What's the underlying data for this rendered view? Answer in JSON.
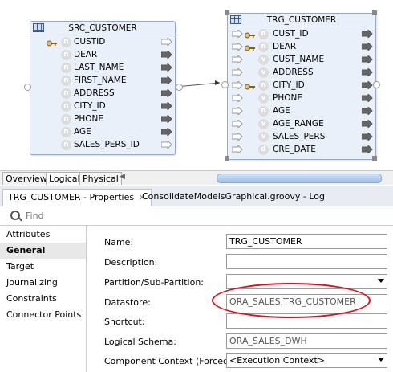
{
  "src_entity": {
    "title": "SRC_CUSTOMER",
    "attributes": [
      {
        "name": "CUSTID",
        "key": true,
        "out": "hollow"
      },
      {
        "name": "DEAR",
        "key": false,
        "out": "filled"
      },
      {
        "name": "LAST_NAME",
        "key": false,
        "out": "filled"
      },
      {
        "name": "FIRST_NAME",
        "key": false,
        "out": "filled"
      },
      {
        "name": "ADDRESS",
        "key": false,
        "out": "filled"
      },
      {
        "name": "CITY_ID",
        "key": false,
        "out": "filled"
      },
      {
        "name": "PHONE",
        "key": false,
        "out": "filled"
      },
      {
        "name": "AGE",
        "key": false,
        "out": "filled"
      },
      {
        "name": "SALES_PERS_ID",
        "key": false,
        "out": "hollow"
      }
    ]
  },
  "trg_entity": {
    "title": "TRG_CUSTOMER",
    "attributes": [
      {
        "name": "CUST_ID",
        "key": true,
        "badge": "n"
      },
      {
        "name": "DEAR",
        "key": true,
        "badge": "n"
      },
      {
        "name": "CUST_NAME",
        "key": false,
        "badge": "v"
      },
      {
        "name": "ADDRESS",
        "key": false,
        "badge": "v"
      },
      {
        "name": "CITY_ID",
        "key": true,
        "badge": "n"
      },
      {
        "name": "PHONE",
        "key": false,
        "badge": "v"
      },
      {
        "name": "AGE",
        "key": false,
        "badge": "n"
      },
      {
        "name": "AGE_RANGE",
        "key": false,
        "badge": "v"
      },
      {
        "name": "SALES_PERS",
        "key": false,
        "badge": "v"
      },
      {
        "name": "CRE_DATE",
        "key": false,
        "badge": "d"
      }
    ]
  },
  "view_tabs": [
    "Overview",
    "Logical",
    "Physical"
  ],
  "panel_tabs": {
    "properties": "TRG_CUSTOMER - Properties",
    "log": "ConsolidateModelsGraphical.groovy - Log",
    "close_glyph": "×"
  },
  "find": {
    "placeholder": "Find"
  },
  "nav": [
    "Attributes",
    "General",
    "Target",
    "Journalizing",
    "Constraints",
    "Connector Points"
  ],
  "form": {
    "name_label": "Name:",
    "name_value": "TRG_CUSTOMER",
    "description_label": "Description:",
    "description_value": "",
    "partition_label": "Partition/Sub-Partition:",
    "partition_value": "",
    "datastore_label": "Datastore:",
    "datastore_value": "ORA_SALES.TRG_CUSTOMER",
    "shortcut_label": "Shortcut:",
    "shortcut_value": "",
    "schema_label": "Logical Schema:",
    "schema_value": "ORA_SALES_DWH",
    "context_label": "Component Context (Forced):",
    "context_value": "<Execution Context>"
  },
  "colors": {
    "highlight": "#d9101e",
    "entity_bg": "#eaf0f9"
  }
}
